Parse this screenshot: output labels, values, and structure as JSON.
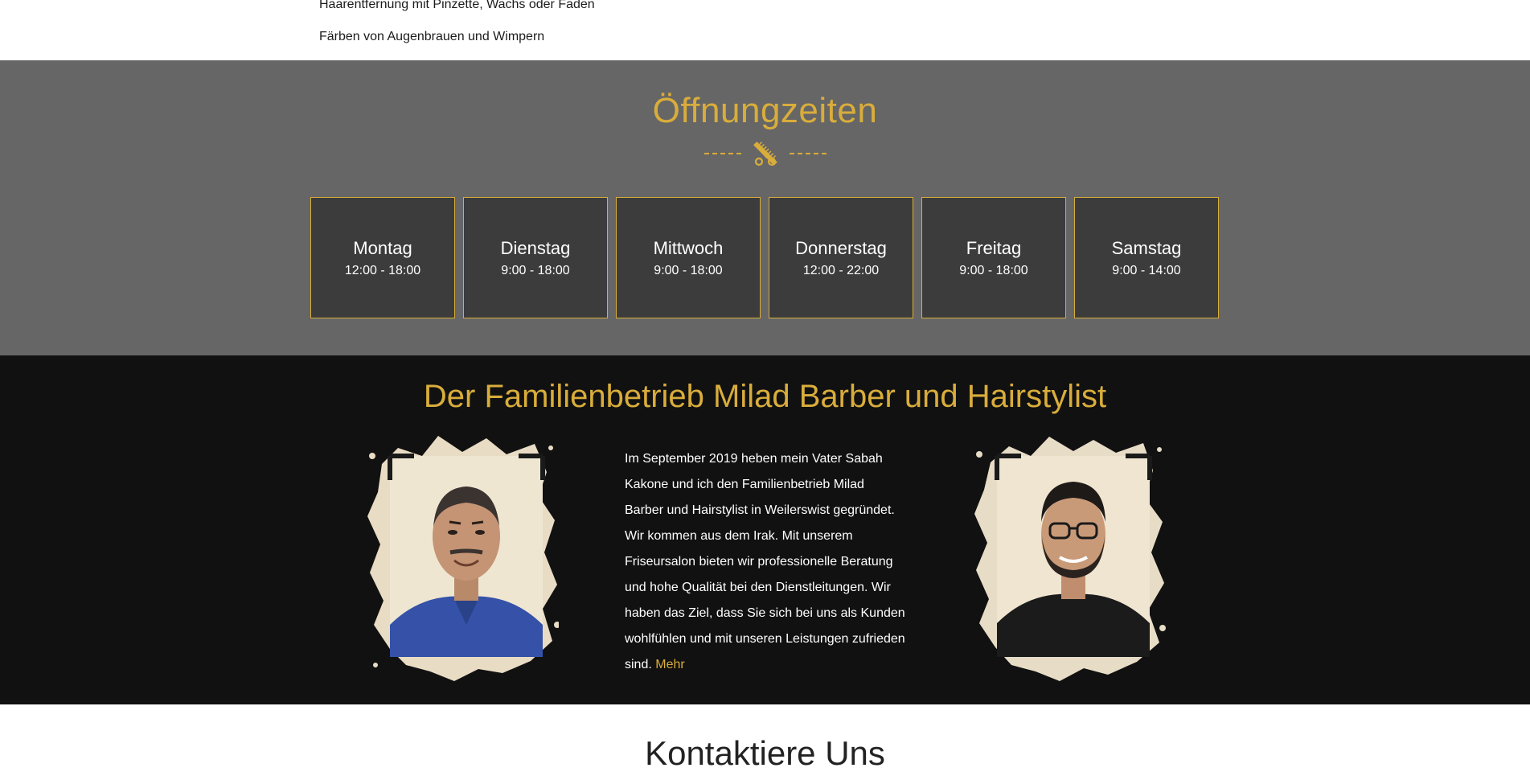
{
  "services": {
    "line1": "Haarentfernung mit Pinzette, Wachs oder Faden",
    "line2": "Färben von Augenbrauen und Wimpern"
  },
  "hours": {
    "title": "Öffnungzeiten",
    "divider_icon": "scissors-comb-icon",
    "days": [
      {
        "name": "Montag",
        "time": "12:00 - 18:00"
      },
      {
        "name": "Dienstag",
        "time": "9:00 - 18:00"
      },
      {
        "name": "Mittwoch",
        "time": "9:00 - 18:00"
      },
      {
        "name": "Donnerstag",
        "time": "12:00 - 22:00"
      },
      {
        "name": "Freitag",
        "time": "9:00 - 18:00"
      },
      {
        "name": "Samstag",
        "time": "9:00 - 14:00"
      }
    ]
  },
  "about": {
    "title": "Der Familienbetrieb Milad Barber und Hairstylist",
    "text": "Im September 2019 heben mein Vater Sabah Kakone und ich den Familienbetrieb Milad Barber und Hairstylist in Weilerswist gegründet. Wir kommen aus dem Irak. Mit unserem Friseursalon bieten wir professionelle Beratung und hohe Qualität bei den Dienstleitungen. Wir haben das Ziel, dass Sie sich bei uns als Kunden wohlfühlen und mit unseren Leistungen zufrieden sind.",
    "more_label": "Mehr"
  },
  "contact": {
    "title": "Kontaktiere Uns"
  },
  "colors": {
    "accent": "#d9ad3b",
    "hours_bg": "#666666",
    "card_bg": "#3c3c3c",
    "about_bg": "#111111"
  }
}
